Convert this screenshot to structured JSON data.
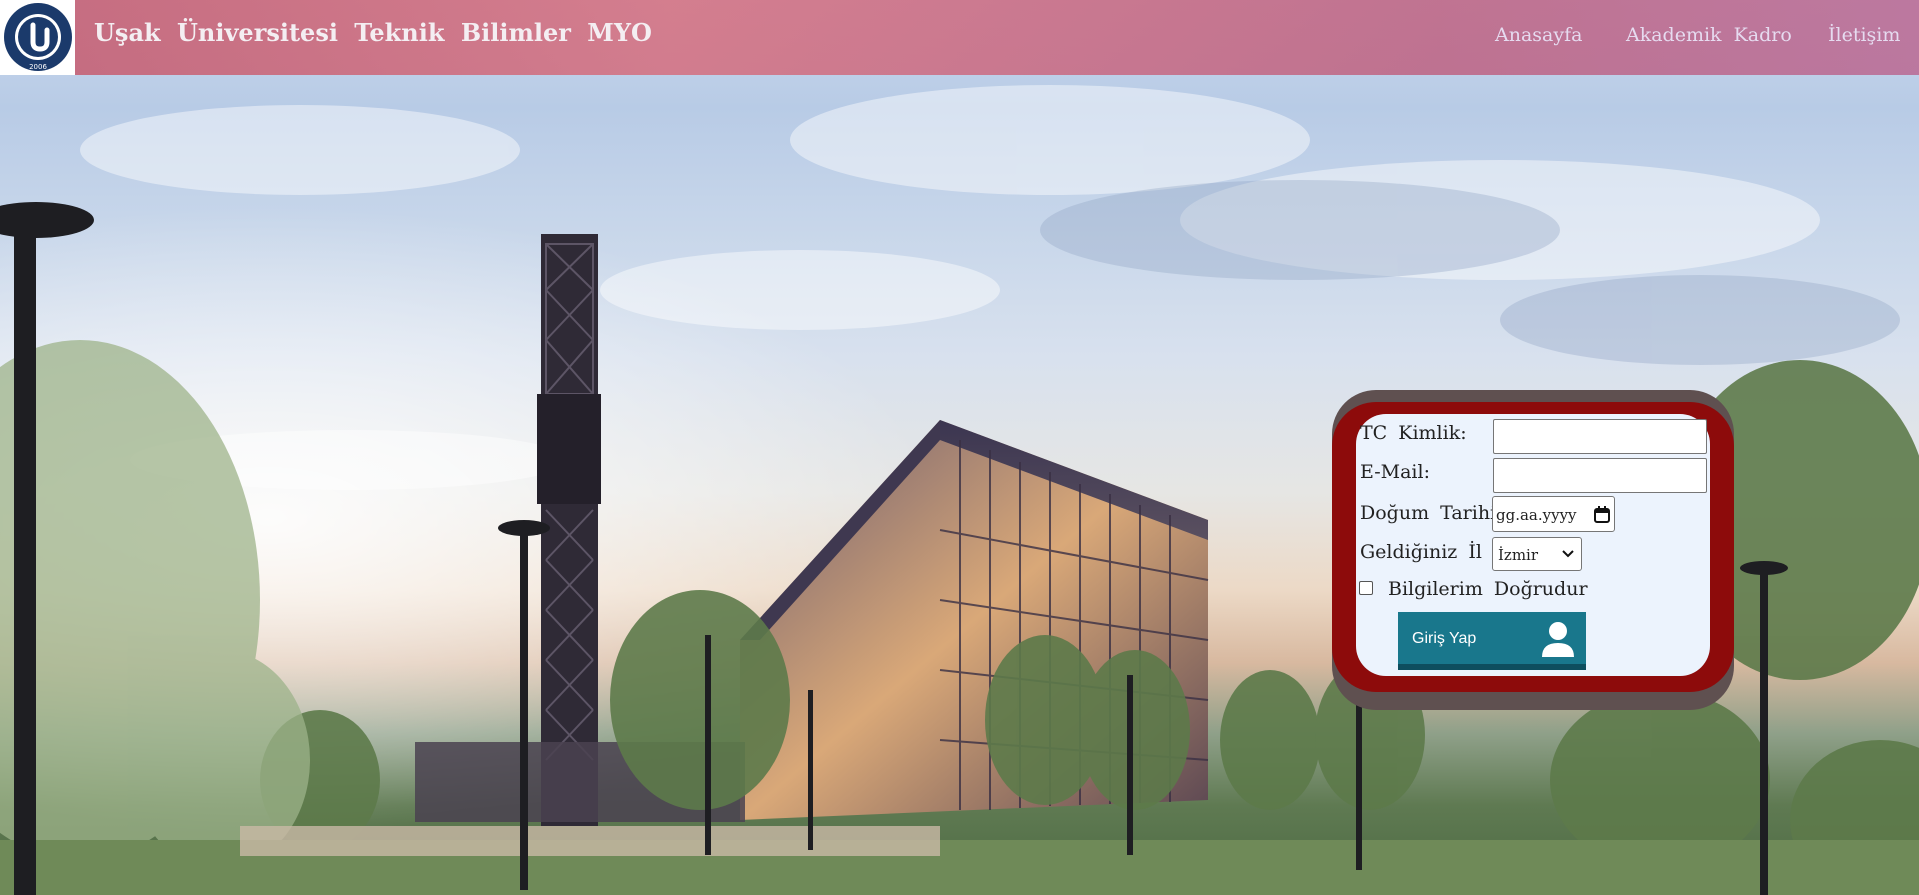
{
  "header": {
    "logo": {
      "icon": "university-seal-icon",
      "ring_text": "T.C. UŞAK ÜNİVERSİTESİ",
      "year": "2006",
      "color": "#1b3a6b"
    },
    "title": "Uşak Üniversitesi Teknik Bilimler MYO",
    "nav": [
      {
        "label": "Anasayfa"
      },
      {
        "label": "Akademik Kadro"
      },
      {
        "label": "İletişim"
      }
    ]
  },
  "form": {
    "tc_label": "TC Kimlik:",
    "tc_value": "",
    "email_label": "E-Mail:",
    "email_value": "",
    "birth_label": "Doğum Tarihi:",
    "birth_placeholder": "gg.aa.yyyy",
    "city_label": "Geldiğiniz İl",
    "city_selected": "İzmir",
    "confirm_label": "Bilgilerim Doğrudur",
    "confirm_checked": false,
    "submit_label": "Giriş Yap"
  },
  "colors": {
    "header_tint": "#c85a6e",
    "panel_border": "#8d0b0b",
    "panel_frame": "#5f5050",
    "panel_bg": "#ecf3fd",
    "button": "#19778c"
  }
}
